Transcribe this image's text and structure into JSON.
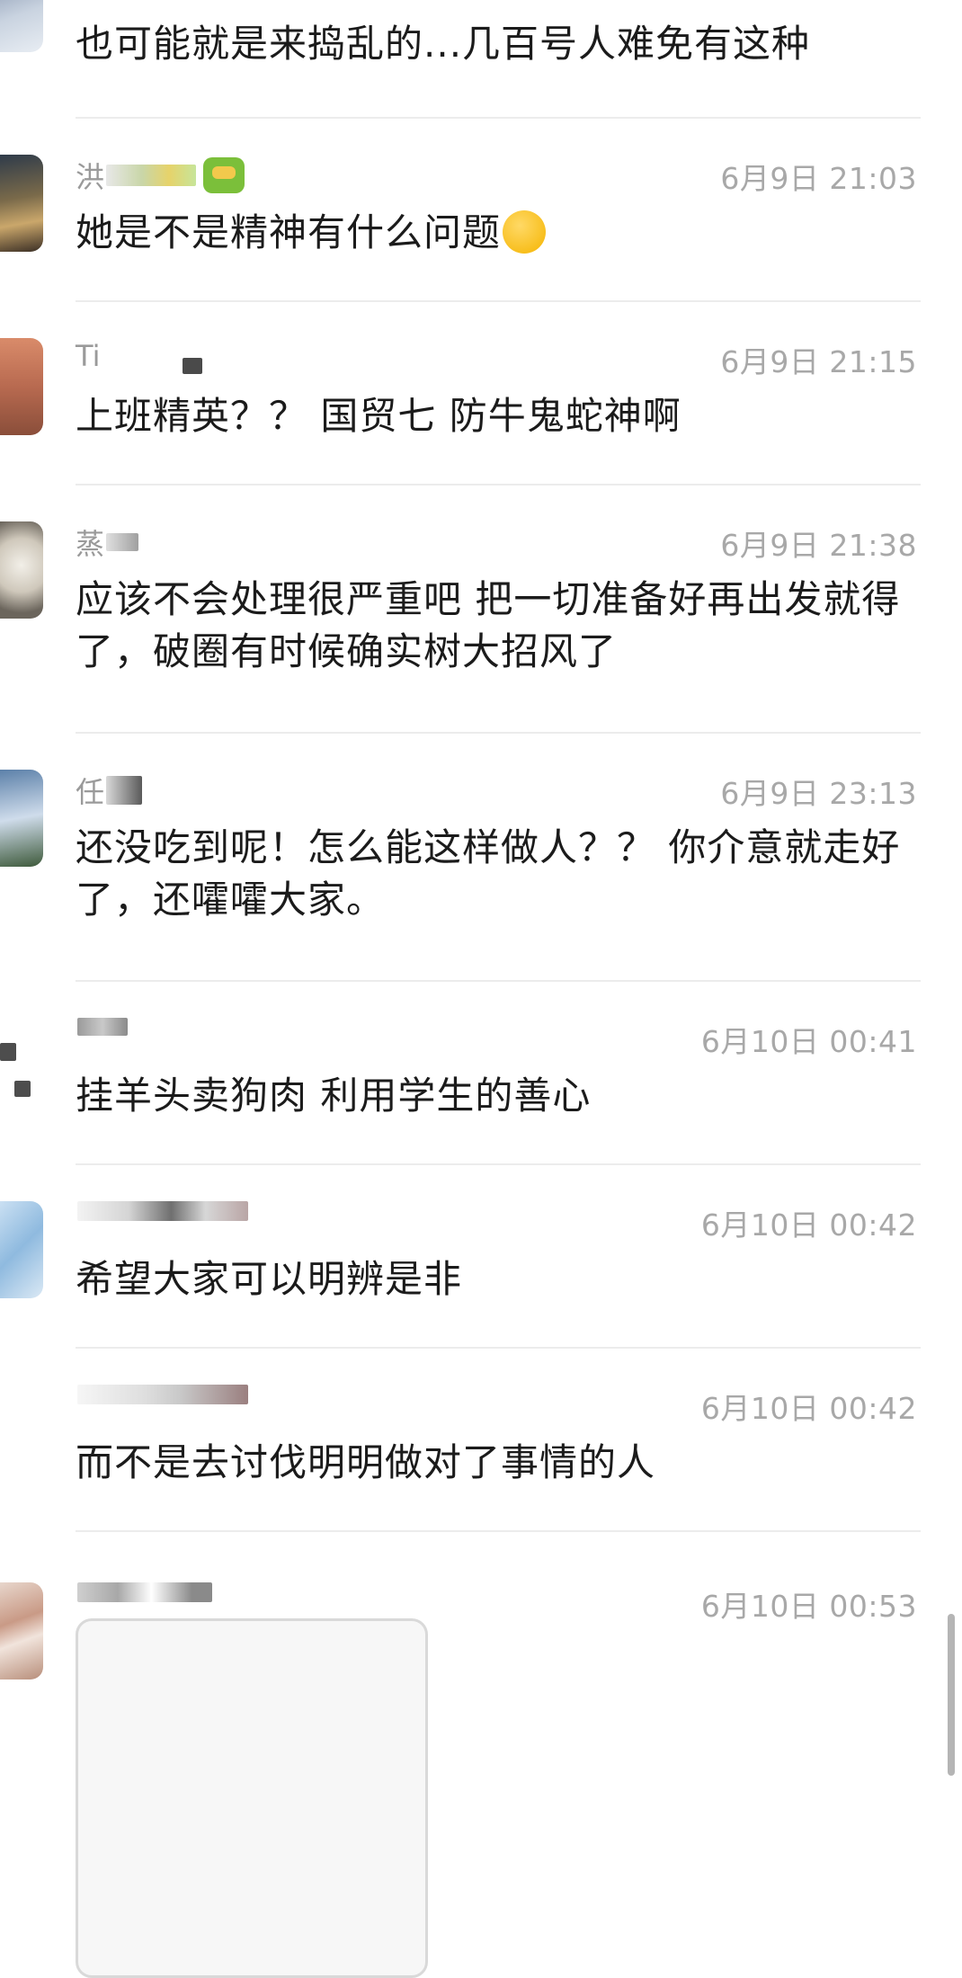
{
  "comments": [
    {
      "name": "",
      "time": "",
      "text": "也可能就是来捣乱的...几百号人难免有这种"
    },
    {
      "name": "洪",
      "time": "6月9日 21:03",
      "text": "她是不是精神有什么问题",
      "emoji": "crying-face-icon"
    },
    {
      "name": "Ti",
      "time": "6月9日 21:15",
      "text": "上班精英？？ 国贸七 防牛鬼蛇神啊"
    },
    {
      "name": "蒸",
      "time": "6月9日 21:38",
      "text": "应该不会处理很严重吧 把一切准备好再出发就得了，破圈有时候确实树大招风了"
    },
    {
      "name": "任",
      "time": "6月9日 23:13",
      "text": "还没吃到呢！怎么能这样做人？？ 你介意就走好了，还嚯嚯大家。"
    },
    {
      "name": "",
      "time": "6月10日 00:41",
      "text": "挂羊头卖狗肉 利用学生的善心"
    },
    {
      "name": "",
      "time": "6月10日 00:42",
      "text": "希望大家可以明辨是非"
    },
    {
      "name": "",
      "time": "6月10日 00:42",
      "text": "而不是去讨伐明明做对了事情的人"
    },
    {
      "name": "",
      "time": "6月10日 00:53",
      "text": ""
    }
  ],
  "colors": {
    "time": "#a8a8a8",
    "text": "#1b1b1b",
    "divider": "#ececec"
  }
}
